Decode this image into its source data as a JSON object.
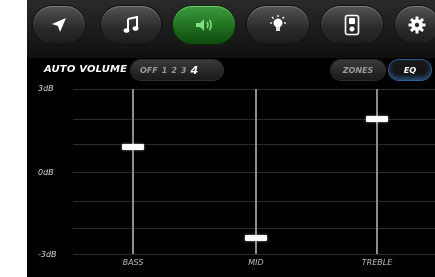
{
  "toolbar": {
    "buttons": [
      {
        "icon": "navigation-arrow-icon",
        "active": false
      },
      {
        "icon": "music-note-icon",
        "active": false
      },
      {
        "icon": "speaker-volume-icon",
        "active": true
      },
      {
        "icon": "lightbulb-icon",
        "active": false
      },
      {
        "icon": "speaker-device-icon",
        "active": false
      },
      {
        "icon": "gear-icon",
        "active": false
      }
    ],
    "active_color": "#2e8b2e"
  },
  "auto_volume": {
    "label": "AUTO VOLUME",
    "levels": [
      "OFF",
      "1",
      "2",
      "3",
      "4"
    ],
    "selected": "4"
  },
  "mode_buttons": {
    "zones_label": "ZONES",
    "eq_label": "EQ",
    "eq_active": true
  },
  "eq": {
    "scale_top": "3dB",
    "scale_mid": "0dB",
    "scale_bottom": "-3dB",
    "range_db": [
      -3,
      3
    ],
    "bands": [
      {
        "label": "BASS",
        "value_db": 0.9
      },
      {
        "label": "MID",
        "value_db": -2.4
      },
      {
        "label": "TREBLE",
        "value_db": 1.9
      }
    ]
  }
}
